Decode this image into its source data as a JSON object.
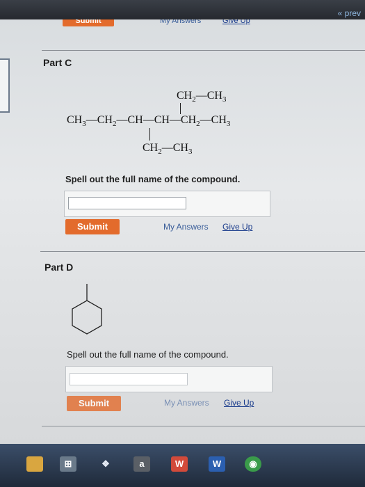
{
  "top": {
    "prev_label": "« prev"
  },
  "top_section": {
    "submit_label": "Submit",
    "my_answers_label": "My Answers",
    "give_up_label": "Give Up"
  },
  "part_c": {
    "title": "Part C",
    "structure": {
      "top_branch": "CH2—CH3",
      "main_chain": "CH3—CH2—CH—CH—CH2—CH3",
      "bottom_branch": "CH2—CH3"
    },
    "prompt": "Spell out the full name of the compound.",
    "answer_value": "",
    "submit_label": "Submit",
    "my_answers_label": "My Answers",
    "give_up_label": "Give Up"
  },
  "part_d": {
    "title": "Part D",
    "prompt": "Spell out the full name of the compound.",
    "answer_value": "",
    "submit_label": "Submit",
    "my_answers_label": "My Answers",
    "give_up_label": "Give Up"
  },
  "taskbar": {
    "icons": [
      {
        "name": "file-explorer-icon",
        "color": "#d9a640"
      },
      {
        "name": "store-icon",
        "color": "#6a7a8a",
        "glyph": "🛍"
      },
      {
        "name": "dropbox-icon",
        "color": "#3c6fd1",
        "glyph": "❖"
      },
      {
        "name": "amazon-icon",
        "color": "#5a5f66",
        "glyph": "a"
      },
      {
        "name": "wolfram-icon",
        "color": "#d24a3a",
        "glyph": "W"
      },
      {
        "name": "word-icon",
        "color": "#2b5fb0",
        "glyph": "W"
      },
      {
        "name": "chrome-icon",
        "color": "#3a9b4a",
        "glyph": "◉"
      }
    ]
  }
}
